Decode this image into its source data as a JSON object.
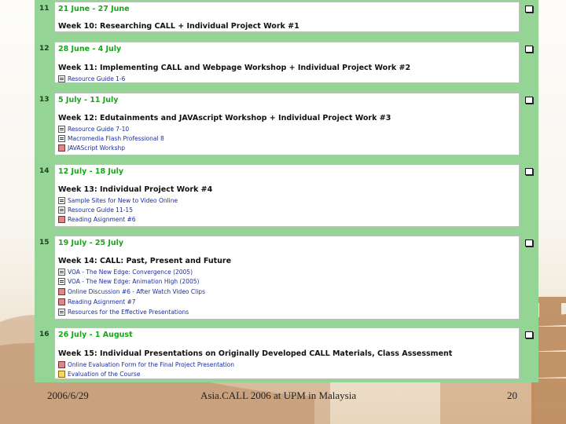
{
  "weeks": [
    {
      "num": "11",
      "dates": "21 June - 27 June",
      "title": "Week 10: Researching CALL + Individual Project Work #1",
      "resources": []
    },
    {
      "num": "12",
      "dates": "28 June - 4 July",
      "title": "Week 11: Implementing CALL and Webpage Workshop + Individual Project Work #2",
      "resources": [
        {
          "label": "Resource Guide 1-6",
          "icon": "document-icon"
        }
      ]
    },
    {
      "num": "13",
      "dates": "5 July - 11 July",
      "title": "Week 12: Edutainments and JAVAscript Workshop + Individual Project Work #3",
      "resources": [
        {
          "label": "Resource Guide 7-10",
          "icon": "document-icon"
        },
        {
          "label": "Macromedia Flash Professional 8",
          "icon": "document-icon"
        },
        {
          "label": "JAVAScript Workshp",
          "icon": "forum-icon"
        }
      ]
    },
    {
      "num": "14",
      "dates": "12 July - 18 July",
      "title": "Week 13: Individual Project Work #4",
      "resources": [
        {
          "label": "Sample Sites for New to Video Online",
          "icon": "document-icon"
        },
        {
          "label": "Resource Guide 11-15",
          "icon": "document-icon"
        },
        {
          "label": "Reading Asignment #6",
          "icon": "forum-icon"
        }
      ]
    },
    {
      "num": "15",
      "dates": "19 July - 25 July",
      "title": "Week 14: CALL: Past, Present and Future",
      "resources": [
        {
          "label": "VOA - The New Edge: Convergence (2005)",
          "icon": "document-icon"
        },
        {
          "label": "VOA - The New Edge: Animation High (2005)",
          "icon": "document-icon"
        },
        {
          "label": "Online Discussion #6 - After Watch Video Clips",
          "icon": "forum-icon"
        },
        {
          "label": "Reading Asignment #7",
          "icon": "forum-icon"
        },
        {
          "label": "Resources for the Effective Presentations",
          "icon": "document-icon"
        }
      ]
    },
    {
      "num": "16",
      "dates": "26 July - 1 August",
      "title": "Week 15: Individual Presentations on Originally Developed CALL Materials, Class Assessment",
      "resources": [
        {
          "label": "Online Evaluation Form for the Final Project Presentation",
          "icon": "forum-icon"
        },
        {
          "label": "Evaluation of the Course",
          "icon": "quiz-icon"
        }
      ]
    }
  ],
  "footer": {
    "date": "2006/6/29",
    "center": "Asia.CALL 2006 at UPM in Malaysia",
    "page": "20"
  }
}
